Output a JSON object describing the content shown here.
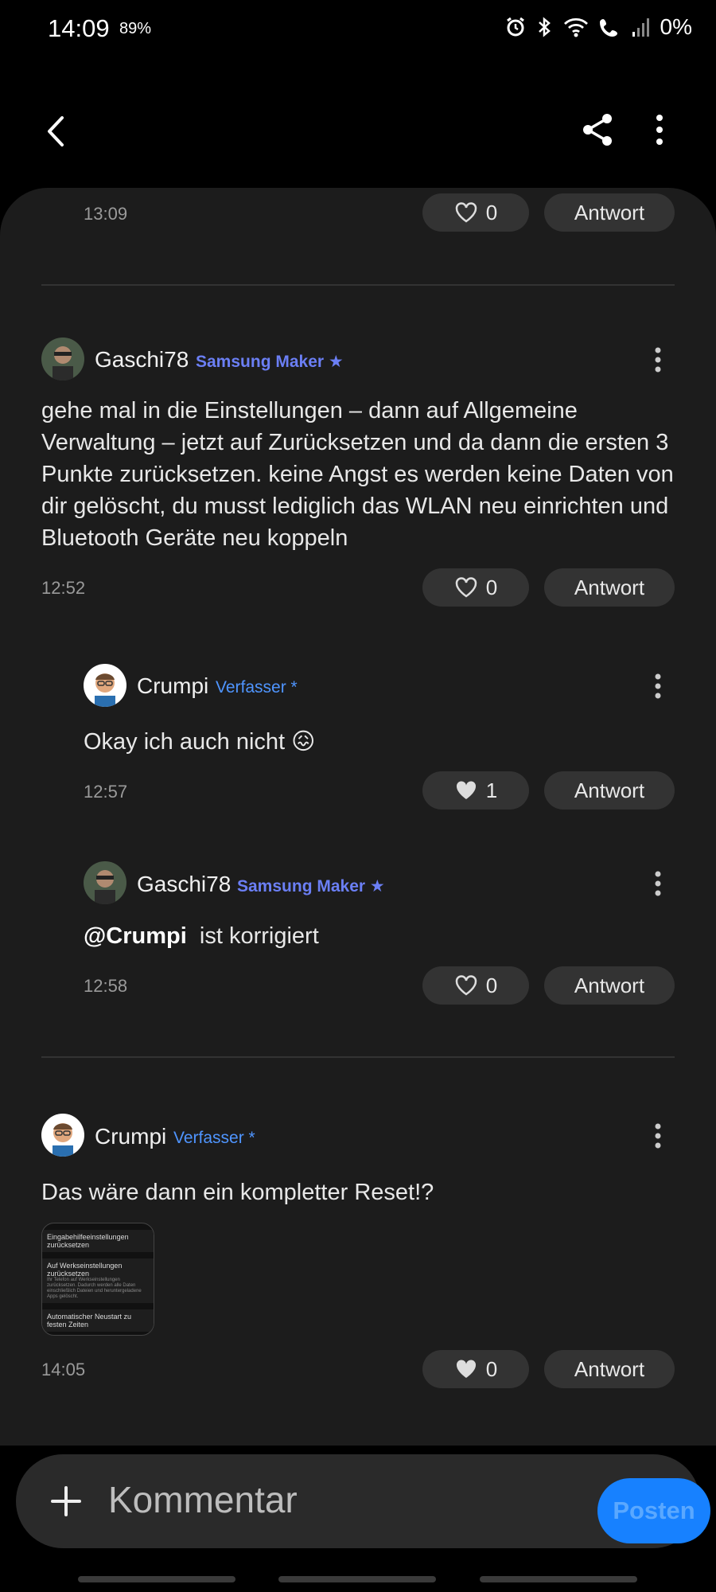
{
  "status_bar": {
    "time": "14:09",
    "battery_small": "89%",
    "battery": "0%",
    "icons": [
      "alarm-icon",
      "bluetooth-icon",
      "wifi-icon",
      "wifi-calling-icon",
      "signal-icon"
    ]
  },
  "header": {
    "back_icon": "chevron-left-icon",
    "share_icon": "share-icon",
    "more_icon": "more-vertical-icon"
  },
  "top_item": {
    "time": "13:09",
    "likes": "0",
    "reply_label": "Antwort"
  },
  "comments": [
    {
      "username": "Gaschi78",
      "badge": "Samsung Maker ★",
      "text": "gehe mal in die Einstellungen – dann auf Allgemeine Verwaltung – jetzt auf Zurücksetzen und da dann die ersten 3 Punkte zurücksetzen. keine Angst es werden keine Daten von dir gelöscht, du musst lediglich das WLAN neu einrichten und Bluetooth Geräte neu koppeln",
      "time": "12:52",
      "likes": "0",
      "reply_label": "Antwort"
    },
    {
      "username": "Crumpi",
      "badge": "Verfasser *",
      "text": "Okay ich auch nicht 😖",
      "time": "12:57",
      "likes": "1",
      "reply_label": "Antwort"
    },
    {
      "username": "Gaschi78",
      "badge": "Samsung Maker ★",
      "mention": "@Crumpi",
      "text": "ist korrigiert",
      "time": "12:58",
      "likes": "0",
      "reply_label": "Antwort"
    },
    {
      "username": "Crumpi",
      "badge": "Verfasser *",
      "text": "Das wäre dann ein kompletter Reset!?",
      "time": "14:05",
      "likes": "0",
      "reply_label": "Antwort",
      "attachment": {
        "line1": "Eingabehilfeeinstellungen zurücksetzen",
        "line2": "Auf Werkseinstellungen zurücksetzen",
        "line2_sub": "Ihr Telefon auf Werkseinstellungen zurücksetzen. Dadurch werden alle Daten einschließlich Dateien und heruntergeladene Apps gelöscht.",
        "line3": "Automatischer Neustart zu festen Zeiten"
      }
    }
  ],
  "composer": {
    "placeholder": "Kommentar",
    "post_label": "Posten"
  },
  "colors": {
    "maker_badge": "#6b7ff5",
    "author_badge": "#4f95ff",
    "post_button": "#1781ff"
  }
}
